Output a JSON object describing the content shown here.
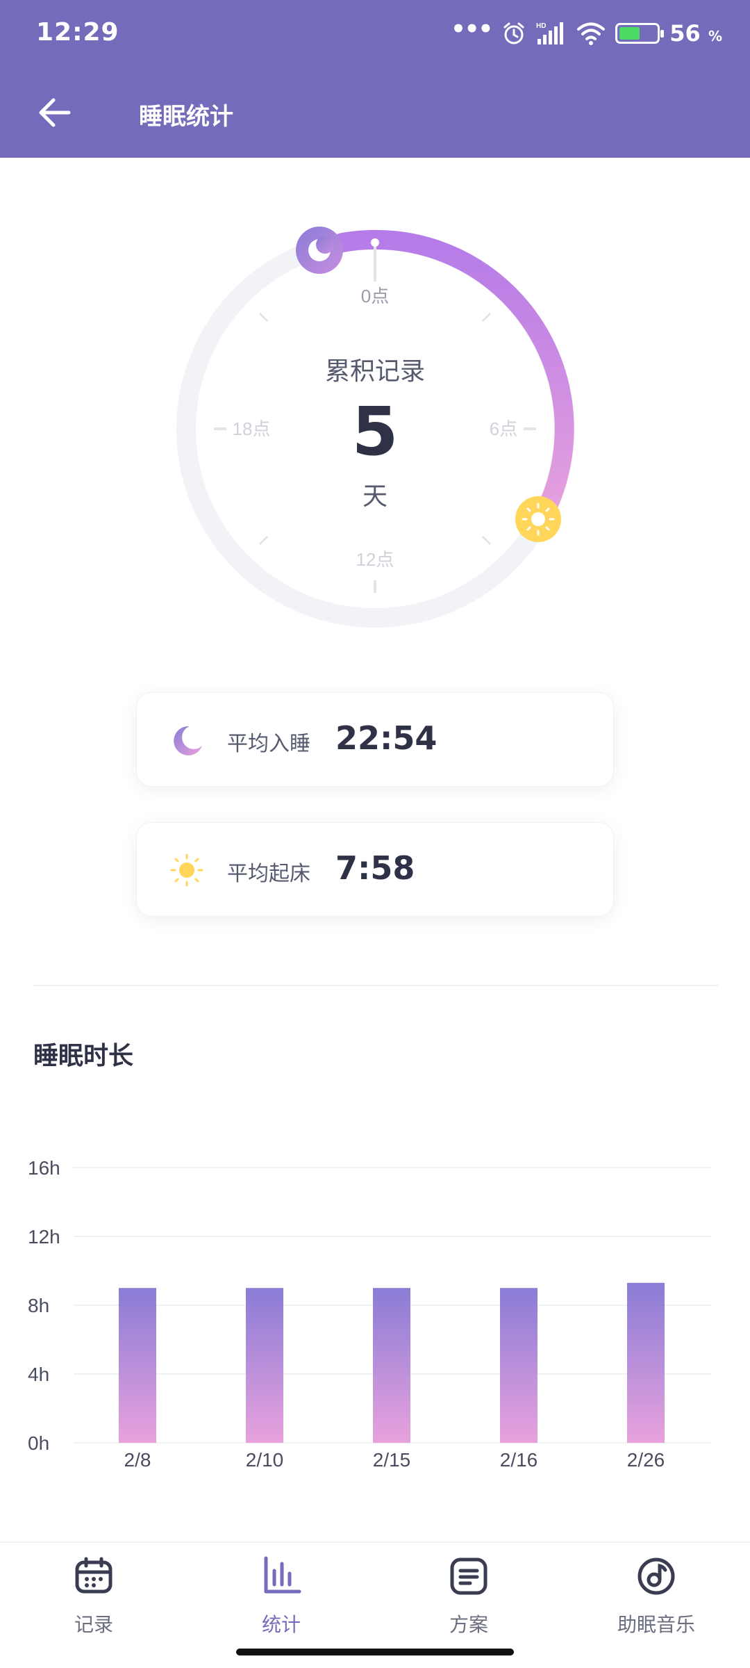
{
  "status_bar": {
    "time": "12:29",
    "battery_percent": 56,
    "battery_text": "56",
    "battery_unit": "%"
  },
  "header": {
    "title": "睡眠统计",
    "back_icon": "arrow-left-icon"
  },
  "summary": {
    "title": "累积记录",
    "count": "5",
    "unit": "天",
    "ticks": {
      "top": "0点",
      "right": "6点",
      "bottom": "12点",
      "left": "18点"
    }
  },
  "stats": {
    "sleep": {
      "label": "平均入睡",
      "value": "22:54",
      "icon": "moon-icon"
    },
    "wake": {
      "label": "平均起床",
      "value": "7:58",
      "icon": "sun-icon"
    }
  },
  "section": {
    "title": "睡眠时长"
  },
  "chart_data": {
    "type": "bar",
    "categories": [
      "2/8",
      "2/10",
      "2/15",
      "2/16",
      "2/26"
    ],
    "values": [
      9,
      9,
      9,
      9,
      9.3
    ],
    "yticks": [
      "0h",
      "4h",
      "8h",
      "12h",
      "16h"
    ],
    "ylim": [
      0,
      16
    ],
    "grid": true,
    "colors": {
      "top": "#8a7cd6",
      "bottom": "#e8a2dd"
    }
  },
  "nav": {
    "items": [
      {
        "label": "记录",
        "icon": "calendar-icon"
      },
      {
        "label": "统计",
        "icon": "bar-chart-icon"
      },
      {
        "label": "方案",
        "icon": "list-doc-icon"
      },
      {
        "label": "助眠音乐",
        "icon": "music-disc-icon"
      }
    ],
    "active_index": 1
  },
  "colors": {
    "header": "#746bba",
    "accent": "#b57be8",
    "sun": "#ffd65a",
    "text": "#2f3247"
  }
}
